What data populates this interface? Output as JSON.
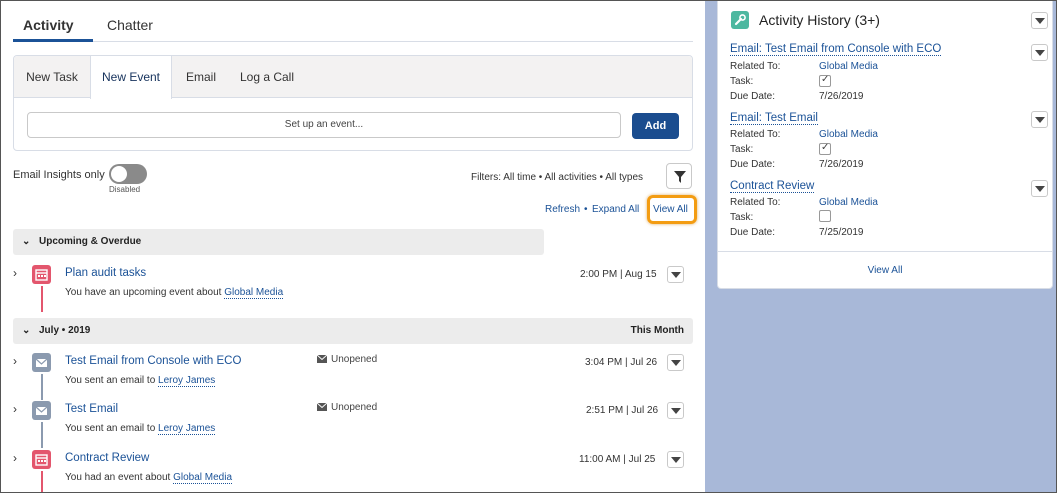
{
  "tabs": [
    {
      "label": "Activity",
      "active": true
    },
    {
      "label": "Chatter",
      "active": false
    }
  ],
  "composer": {
    "subtabs": [
      "New Task",
      "New Event",
      "Email",
      "Log a Call"
    ],
    "active_subtab": "New Event",
    "event_input_text": "Set up an event...",
    "add_label": "Add"
  },
  "insights": {
    "label": "Email Insights only",
    "toggle_state": "Disabled"
  },
  "filters": {
    "text": "Filters: All time • All activities • All types",
    "refresh": "Refresh",
    "separator": "•",
    "expand_all": "Expand All",
    "view_all": "View All"
  },
  "sections": [
    {
      "title": "Upcoming & Overdue",
      "right": "",
      "items": [
        {
          "icon": "calendar-icon",
          "color": "#e3566d",
          "title": "Plan audit tasks",
          "sub_prefix": "You have an upcoming event about",
          "sub_link": "Global Media",
          "status": "",
          "time": "2:00 PM | Aug 15"
        }
      ]
    },
    {
      "title": "July • 2019",
      "right": "This Month",
      "items": [
        {
          "icon": "email-icon",
          "color": "#8b9aaf",
          "title": "Test Email from Console with ECO",
          "sub_prefix": "You sent an email to",
          "sub_link": "Leroy James",
          "status": "Unopened",
          "time": "3:04 PM | Jul 26"
        },
        {
          "icon": "email-icon",
          "color": "#8b9aaf",
          "title": "Test Email",
          "sub_prefix": "You sent an email to",
          "sub_link": "Leroy James",
          "status": "Unopened",
          "time": "2:51 PM | Jul 26"
        },
        {
          "icon": "calendar-icon",
          "color": "#e3566d",
          "title": "Contract Review",
          "sub_prefix": "You had an event about",
          "sub_link": "Global Media",
          "status": "",
          "time": "11:00 AM | Jul 25"
        }
      ]
    }
  ],
  "history": {
    "title": "Activity History (3+)",
    "labels": {
      "related": "Related To:",
      "task": "Task:",
      "due": "Due Date:"
    },
    "items": [
      {
        "title": "Email: Test Email from Console with ECO",
        "related": "Global Media",
        "task": true,
        "due": "7/26/2019"
      },
      {
        "title": "Email: Test Email",
        "related": "Global Media",
        "task": true,
        "due": "7/26/2019"
      },
      {
        "title": "Contract Review",
        "related": "Global Media",
        "task": false,
        "due": "7/25/2019"
      }
    ],
    "view_all": "View All"
  },
  "colors": {
    "accent": "#1b5297",
    "add_button": "#1b4d8f",
    "highlight": "#f39c12",
    "right_background": "#a8b8d8",
    "history_icon": "#4db8a0"
  }
}
